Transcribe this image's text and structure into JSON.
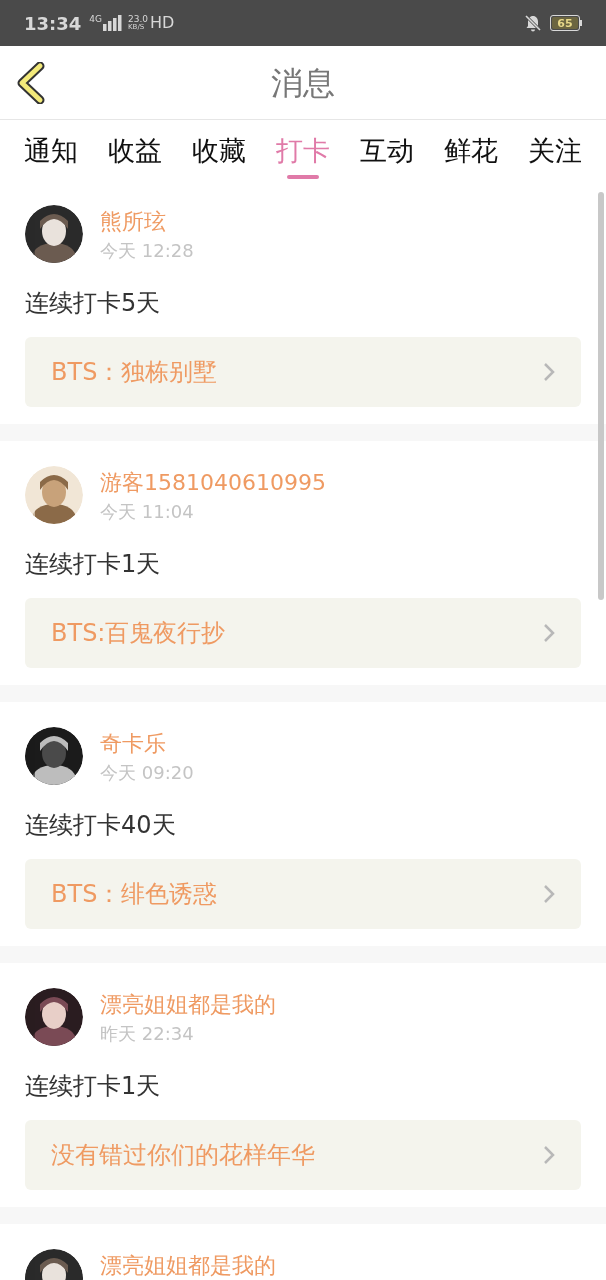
{
  "status_bar": {
    "time": "13:34",
    "network": "4G",
    "speed": "23.0",
    "speed_unit": "KB/S",
    "hd": "HD",
    "battery": "65"
  },
  "header": {
    "title": "消息"
  },
  "tabs": [
    {
      "label": "通知",
      "selected": false
    },
    {
      "label": "收益",
      "selected": false
    },
    {
      "label": "收藏",
      "selected": false
    },
    {
      "label": "打卡",
      "selected": true
    },
    {
      "label": "互动",
      "selected": false
    },
    {
      "label": "鲜花",
      "selected": false
    },
    {
      "label": "关注",
      "selected": false
    }
  ],
  "messages": [
    {
      "user": "熊所玹",
      "time": "今天 12:28",
      "text": "连续打卡5天",
      "link": "BTS：独栋别墅"
    },
    {
      "user": "游客1581040610995",
      "time": "今天 11:04",
      "text": "连续打卡1天",
      "link": "BTS:百鬼夜行抄"
    },
    {
      "user": "奇卡乐",
      "time": "今天 09:20",
      "text": "连续打卡40天",
      "link": "BTS：绯色诱惑"
    },
    {
      "user": "漂亮姐姐都是我的",
      "time": "昨天 22:34",
      "text": "连续打卡1天",
      "link": "没有错过你们的花样年华"
    },
    {
      "user": "漂亮姐姐都是我的"
    }
  ]
}
